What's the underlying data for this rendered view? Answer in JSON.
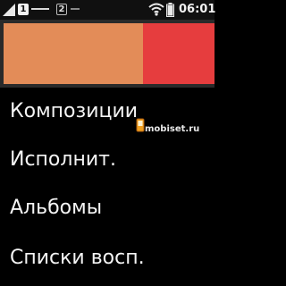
{
  "status_bar": {
    "signal_icon": "signal-strength-icon",
    "sim1_label": "1",
    "sim2_label": "2",
    "wifi_icon": "wifi-icon",
    "battery_icon": "battery-icon",
    "time": "06:01"
  },
  "hero": {
    "left_color": "#e38c58",
    "right_color": "#e63d3e"
  },
  "menu": {
    "items": [
      {
        "label": "Композиции"
      },
      {
        "label": "Исполнит."
      },
      {
        "label": "Альбомы"
      },
      {
        "label": "Списки восп."
      }
    ]
  },
  "watermark": {
    "text": "mobiset.ru",
    "icon": "phone-logo-icon"
  }
}
